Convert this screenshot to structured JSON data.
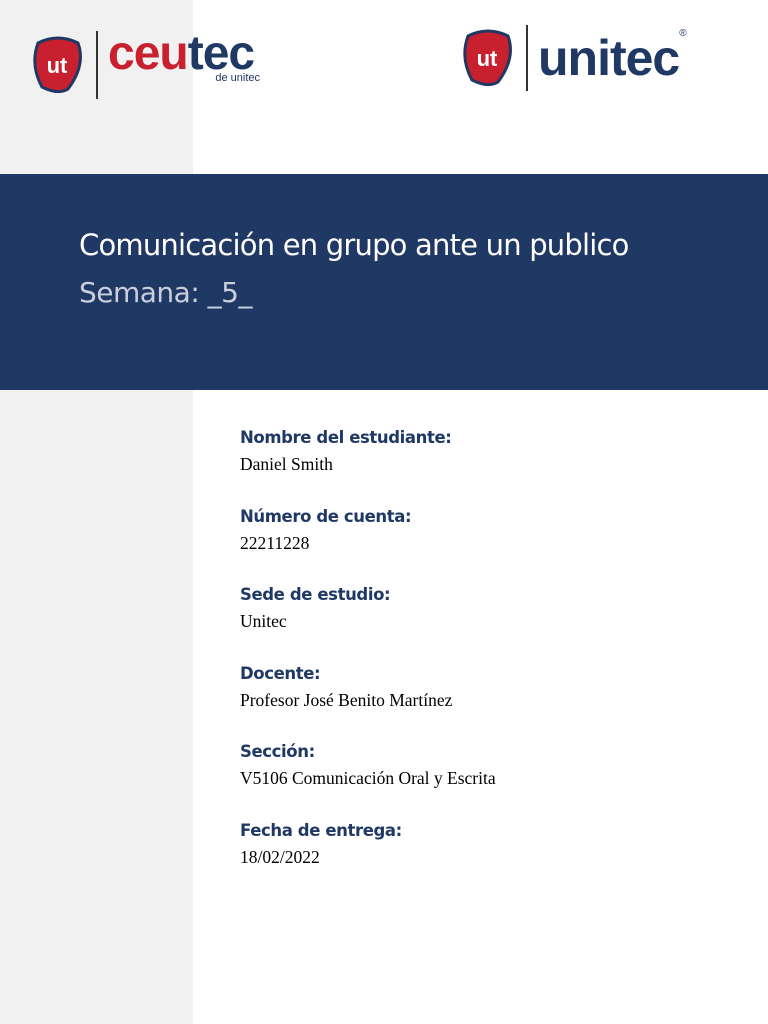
{
  "logos": {
    "ceutec": {
      "name": "ceutec",
      "sub": "de unitec",
      "mark": "ut"
    },
    "unitec": {
      "name": "unitec",
      "mark": "ut",
      "registered": "®"
    }
  },
  "colors": {
    "navy": "#203864",
    "red": "#c8202f",
    "sidebar": "#f1f1f1"
  },
  "banner": {
    "title": "Comunicación en grupo ante un publico",
    "subtitle": "Semana: _5_"
  },
  "fields": [
    {
      "label": "Nombre del estudiante:",
      "value": "Daniel Smith"
    },
    {
      "label": "Número de cuenta:",
      "value": "22211228"
    },
    {
      "label": "Sede de estudio:",
      "value": "Unitec"
    },
    {
      "label": "Docente:",
      "value": "Profesor José Benito Martínez"
    },
    {
      "label": "Sección:",
      "value": "V5106 Comunicación Oral y Escrita"
    },
    {
      "label": "Fecha de entrega:",
      "value": "18/02/2022"
    }
  ]
}
